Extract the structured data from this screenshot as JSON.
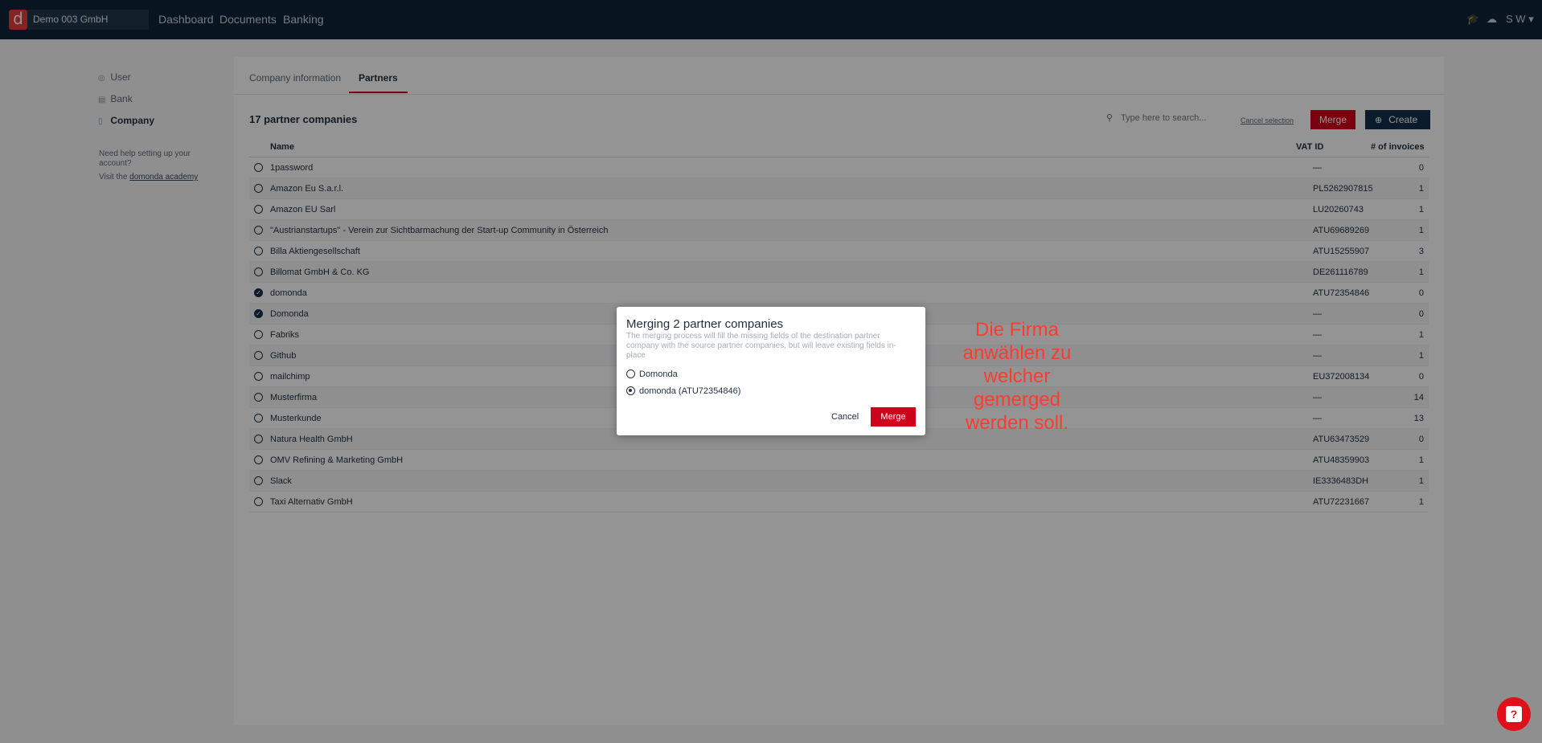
{
  "topbar": {
    "logo_letter": "d",
    "company": "Demo 003 GmbH",
    "nav": [
      "Dashboard",
      "Documents",
      "Banking"
    ],
    "user_initials": "S W"
  },
  "sidebar": {
    "items": [
      {
        "label": "User",
        "icon": "person-icon"
      },
      {
        "label": "Bank",
        "icon": "bank-icon"
      },
      {
        "label": "Company",
        "icon": "building-icon"
      }
    ],
    "help_line1": "Need help setting up your account?",
    "help_prefix": "Visit the",
    "help_link": "domonda academy"
  },
  "tabs": [
    {
      "label": "Company information"
    },
    {
      "label": "Partners"
    }
  ],
  "partners": {
    "count_title": "17 partner companies",
    "search_placeholder": "Type here to search...",
    "cancel_selection": "Cancel selection",
    "merge_label": "Merge",
    "create_label": "Create",
    "columns": {
      "name": "Name",
      "vat": "VAT ID",
      "invoices": "# of invoices"
    },
    "rows": [
      {
        "name": "1password",
        "vat": "—",
        "invoices": "0",
        "checked": false
      },
      {
        "name": "Amazon Eu S.a.r.l.",
        "vat": "PL5262907815",
        "invoices": "1",
        "checked": false
      },
      {
        "name": "Amazon EU Sarl",
        "vat": "LU20260743",
        "invoices": "1",
        "checked": false
      },
      {
        "name": "\"Austrianstartups\" - Verein zur Sichtbarmachung der Start-up Community in Österreich",
        "vat": "ATU69689269",
        "invoices": "1",
        "checked": false
      },
      {
        "name": "Billa Aktiengesellschaft",
        "vat": "ATU15255907",
        "invoices": "3",
        "checked": false
      },
      {
        "name": "Billomat GmbH & Co. KG",
        "vat": "DE261116789",
        "invoices": "1",
        "checked": false
      },
      {
        "name": "domonda",
        "vat": "ATU72354846",
        "invoices": "0",
        "checked": true
      },
      {
        "name": "Domonda",
        "vat": "—",
        "invoices": "0",
        "checked": true
      },
      {
        "name": "Fabriks",
        "vat": "—",
        "invoices": "1",
        "checked": false
      },
      {
        "name": "Github",
        "vat": "—",
        "invoices": "1",
        "checked": false
      },
      {
        "name": "mailchimp",
        "vat": "EU372008134",
        "invoices": "0",
        "checked": false
      },
      {
        "name": "Musterfirma",
        "vat": "—",
        "invoices": "14",
        "checked": false
      },
      {
        "name": "Musterkunde",
        "vat": "—",
        "invoices": "13",
        "checked": false
      },
      {
        "name": "Natura Health GmbH",
        "vat": "ATU63473529",
        "invoices": "0",
        "checked": false
      },
      {
        "name": "OMV Refining & Marketing GmbH",
        "vat": "ATU48359903",
        "invoices": "1",
        "checked": false
      },
      {
        "name": "Slack",
        "vat": "IE3336483DH",
        "invoices": "1",
        "checked": false
      },
      {
        "name": "Taxi Alternativ GmbH",
        "vat": "ATU72231667",
        "invoices": "1",
        "checked": false
      }
    ]
  },
  "modal": {
    "title": "Merging 2 partner companies",
    "description": "The merging process will fill the missing fields of the destination partner company with the source partner companies, but will leave existing fields in-place",
    "options": [
      {
        "label": "Domonda",
        "selected": false
      },
      {
        "label": "domonda (ATU72354846)",
        "selected": true
      }
    ],
    "cancel_label": "Cancel",
    "merge_label": "Merge"
  },
  "annotation": "Die Firma anwählen zu welcher gemerged werden soll.",
  "colors": {
    "accent": "#d0021b",
    "topbar": "#0f2436",
    "create": "#15304a",
    "annotation": "#ff3b30"
  }
}
